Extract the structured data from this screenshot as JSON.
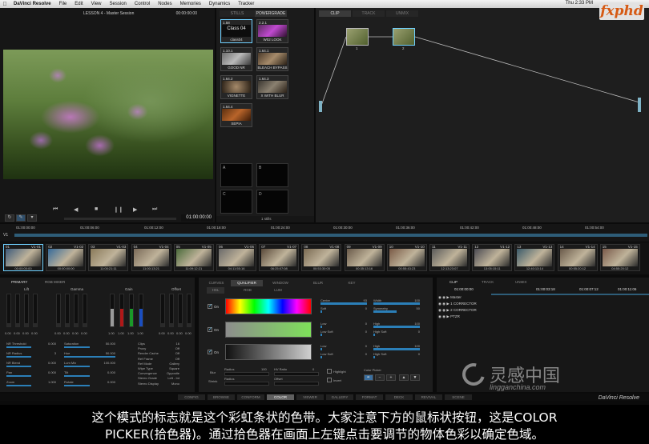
{
  "menubar": {
    "app": "DaVinci Resolve",
    "items": [
      "File",
      "Edit",
      "View",
      "Session",
      "Control",
      "Nodes",
      "Memories",
      "Dynamics",
      "Tracker"
    ],
    "clock": "Thu 2:33 PM",
    "user": "fxphd"
  },
  "viewer": {
    "title": "LESSON 4 - Master Session",
    "top_timecode": "00:00:00:00",
    "timecode": "01:00:00:00"
  },
  "gallery": {
    "tabs": [
      "STILLS",
      "POWERGRADE"
    ],
    "stills": [
      {
        "num": "1.58",
        "name": "class04",
        "label": "Class 04"
      },
      {
        "num": "2.2.1",
        "name": "W02 LOOK",
        "label": ""
      },
      {
        "num": "1.10.1",
        "name": "GOOD NR",
        "label": ""
      },
      {
        "num": "1.64.1",
        "name": "BLEACH BYPASS",
        "label": ""
      },
      {
        "num": "1.64.2",
        "name": "VIGNETTE",
        "label": ""
      },
      {
        "num": "1.64.3",
        "name": "X WITH BLUR",
        "label": ""
      },
      {
        "num": "1.64.4",
        "name": "SEPIA",
        "label": ""
      }
    ],
    "memories": [
      "A",
      "B",
      "C",
      "D"
    ],
    "footer": "1 stills"
  },
  "nodes": {
    "tabs": [
      "CLIP",
      "TRACK",
      "UNMIX"
    ],
    "node_labels": [
      "1",
      "2"
    ]
  },
  "timeline": {
    "track": "V1",
    "timecodes": [
      "01:00:00:00",
      "01:00:06:00",
      "01:00:12:00",
      "01:00:18:00",
      "01:00:24:00",
      "01:00:30:00",
      "01:00:36:00",
      "01:00:42:00",
      "01:00:48:00",
      "01:00:54:00"
    ],
    "clips": [
      {
        "idx": "01",
        "label": "V1-01",
        "tc": "00:00:00:00"
      },
      {
        "idx": "02",
        "label": "V1-02",
        "tc": "00:00:00:00"
      },
      {
        "idx": "03",
        "label": "V1-03",
        "tc": "11:00:21:11"
      },
      {
        "idx": "04",
        "label": "V1-04",
        "tc": "11:00:13:21"
      },
      {
        "idx": "05",
        "label": "V1-05",
        "tc": "11:09:12:21"
      },
      {
        "idx": "06",
        "label": "V1-06",
        "tc": "04:11:55:16"
      },
      {
        "idx": "07",
        "label": "V1-07",
        "tc": "06:25:07:08"
      },
      {
        "idx": "08",
        "label": "V1-08",
        "tc": "00:53:30:05"
      },
      {
        "idx": "09",
        "label": "V1-09",
        "tc": "00:35:13:16"
      },
      {
        "idx": "10",
        "label": "V1-10",
        "tc": "00:55:43:23"
      },
      {
        "idx": "11",
        "label": "V1-11",
        "tc": "12:13:23:07"
      },
      {
        "idx": "12",
        "label": "V1-12",
        "tc": "13:05:15:11"
      },
      {
        "idx": "13",
        "label": "V1-13",
        "tc": "12:40:13:14"
      },
      {
        "idx": "14",
        "label": "V1-14",
        "tc": "00:55:20:12"
      },
      {
        "idx": "15",
        "label": "V1-15",
        "tc": "04:55:20:12"
      }
    ]
  },
  "primary": {
    "tabs": [
      "PRIMARY",
      "RGB MIXER"
    ],
    "groups": [
      "Lift",
      "Gamma",
      "Gain",
      "Offset"
    ],
    "values": [
      "0.00",
      "0.00",
      "0.00",
      "0.00",
      "0.00",
      "0.00",
      "0.00",
      "0.00",
      "1.00",
      "1.00",
      "1.00",
      "1.00",
      "0.00",
      "0.00",
      "0.00",
      "0.00"
    ],
    "params_left": [
      {
        "name": "NR Threshold",
        "value": "0.000"
      },
      {
        "name": "NR Radius",
        "value": "3"
      },
      {
        "name": "NR Blend",
        "value": "0.000"
      },
      {
        "name": "Pan",
        "value": "0.000"
      },
      {
        "name": "Zoom",
        "value": "1.000"
      }
    ],
    "params_mid": [
      {
        "name": "Saturation",
        "value": "50.000"
      },
      {
        "name": "Hue",
        "value": "50.000"
      },
      {
        "name": "Lum Mix",
        "value": "100.000"
      },
      {
        "name": "Tilt",
        "value": "0.000"
      },
      {
        "name": "Rotate",
        "value": "0.000"
      }
    ],
    "params_right": [
      {
        "name": "Clips",
        "value": "16"
      },
      {
        "name": "Proxy",
        "value": "Off"
      },
      {
        "name": "Render Cache",
        "value": "Off"
      },
      {
        "name": "Ref Frame",
        "value": "Off"
      },
      {
        "name": "Ref Mode",
        "value": "Gallery"
      },
      {
        "name": "Wipe Type",
        "value": "Square"
      },
      {
        "name": "Convergence",
        "value": "Opposite"
      },
      {
        "name": "Stereo Grade",
        "value": "Left - Int"
      },
      {
        "name": "Stereo Display",
        "value": "Mono"
      }
    ]
  },
  "qualifier": {
    "tabs": [
      "CURVES",
      "QUALIFIER",
      "WINDOW",
      "BLUR",
      "KEY"
    ],
    "subtabs": [
      "HSL",
      "RGB",
      "LUM"
    ],
    "on_label": "On",
    "fields": [
      {
        "name": "Center",
        "value": "93"
      },
      {
        "name": "Width",
        "value": "100"
      },
      {
        "name": "Soft",
        "value": "0"
      },
      {
        "name": "Symmetry",
        "value": "50"
      },
      {
        "name": "Low",
        "value": "0"
      },
      {
        "name": "High",
        "value": "100"
      },
      {
        "name": "Low Soft",
        "value": "0"
      },
      {
        "name": "High Soft",
        "value": "0"
      },
      {
        "name": "Low",
        "value": "0"
      },
      {
        "name": "High",
        "value": "100"
      },
      {
        "name": "Low Soft",
        "value": "0"
      },
      {
        "name": "High Soft",
        "value": "0"
      }
    ],
    "blur_label": "Blur",
    "shrink_label": "Shrink",
    "radius_label": "Radius",
    "blur_radius": "100",
    "hv_ratio": "HV Ratio",
    "hv_value": "0",
    "offset": "Offset",
    "highlight": "Highlight",
    "invert": "Invert",
    "color_picker": "Color Picker"
  },
  "keyframes": {
    "tabs": [
      "CLIP",
      "TRACK",
      "UNMIX"
    ],
    "timecodes": [
      "01:00:00:00",
      "01:00:03:18",
      "01:00:07:12",
      "01:00:11:06"
    ],
    "rows": [
      "Master",
      "CORRECTOR",
      "CORRECTOR",
      "PTZR"
    ]
  },
  "pages": [
    "CONFIG",
    "BROWSE",
    "CONFORM",
    "COLOR",
    "VIEWER",
    "GALLERY",
    "FORMAT",
    "DECK",
    "REVIVAL",
    "SCENE"
  ],
  "active_page": "COLOR",
  "brand": "DaVinci Resolve",
  "watermark": {
    "cn": "灵感中国",
    "url": "lingganchina.com"
  },
  "subtitles": [
    "这个模式的标志就是这个彩虹条状的色带。大家注意下方的鼠标状按钮，这是COLOR",
    "PICKER(拾色器)。通过拾色器在画面上左键点击要调节的物体色彩以确定色域。"
  ]
}
